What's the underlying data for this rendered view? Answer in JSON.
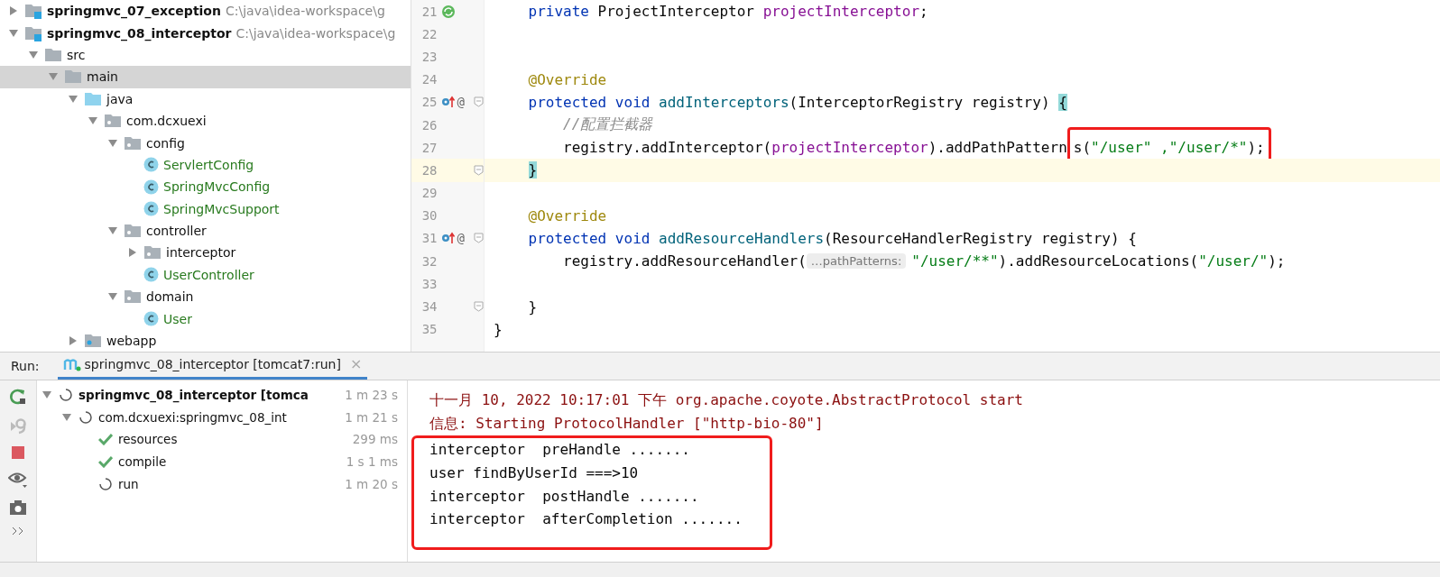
{
  "project_tree": [
    {
      "label": "springmvc_07_exception",
      "kind": "module",
      "path": "C:\\java\\idea-workspace\\g",
      "expanded": false,
      "selected": false
    },
    {
      "label": "springmvc_08_interceptor",
      "kind": "module",
      "path": "C:\\java\\idea-workspace\\g",
      "expanded": true,
      "selected": false,
      "children": [
        {
          "label": "src",
          "kind": "folder",
          "expanded": true,
          "selected": false,
          "children": [
            {
              "label": "main",
              "kind": "folder",
              "expanded": true,
              "selected": true,
              "children": [
                {
                  "label": "java",
                  "kind": "source-folder",
                  "expanded": true,
                  "selected": false,
                  "children": [
                    {
                      "label": "com.dcxuexi",
                      "kind": "package",
                      "expanded": true,
                      "selected": false,
                      "children": [
                        {
                          "label": "config",
                          "kind": "package",
                          "expanded": true,
                          "selected": false,
                          "children": [
                            {
                              "label": "ServlertConfig",
                              "kind": "class",
                              "selected": false
                            },
                            {
                              "label": "SpringMvcConfig",
                              "kind": "class",
                              "selected": false
                            },
                            {
                              "label": "SpringMvcSupport",
                              "kind": "class",
                              "selected": false
                            }
                          ]
                        },
                        {
                          "label": "controller",
                          "kind": "package",
                          "expanded": true,
                          "selected": false,
                          "children": [
                            {
                              "label": "interceptor",
                              "kind": "package",
                              "expanded": false,
                              "selected": false
                            },
                            {
                              "label": "UserController",
                              "kind": "class",
                              "selected": false
                            }
                          ]
                        },
                        {
                          "label": "domain",
                          "kind": "package",
                          "expanded": true,
                          "selected": false,
                          "children": [
                            {
                              "label": "User",
                              "kind": "class",
                              "selected": false
                            }
                          ]
                        }
                      ]
                    }
                  ]
                },
                {
                  "label": "webapp",
                  "kind": "webapp",
                  "expanded": false,
                  "selected": false
                }
              ]
            }
          ]
        }
      ]
    }
  ],
  "editor": {
    "lines": [
      {
        "number": "21",
        "gutter": {
          "kind": "bean"
        },
        "fold": false,
        "current": false,
        "tokens": [
          {
            "text": "    private ",
            "kind": "keyword"
          },
          {
            "text": "ProjectInterceptor ",
            "kind": "plain"
          },
          {
            "text": "projectInterceptor",
            "kind": "field"
          },
          {
            "text": ";",
            "kind": "plain"
          }
        ]
      },
      {
        "number": "22",
        "fold": false,
        "current": false
      },
      {
        "number": "23",
        "fold": false,
        "current": false
      },
      {
        "number": "24",
        "fold": false,
        "current": false,
        "tokens": [
          {
            "text": "    @Override",
            "kind": "annotation"
          }
        ]
      },
      {
        "number": "25",
        "gutter": {
          "kind": "override",
          "text": "@"
        },
        "fold": true,
        "current": false,
        "tokens": [
          {
            "text": "    protected void ",
            "kind": "keyword"
          },
          {
            "text": "addInterceptors",
            "kind": "method"
          },
          {
            "text": "(InterceptorRegistry registry) ",
            "kind": "plain"
          },
          {
            "text": "{",
            "kind": "brace"
          }
        ]
      },
      {
        "number": "26",
        "fold": false,
        "current": false,
        "tokens": [
          {
            "text": "        //配置拦截器",
            "kind": "comment"
          }
        ]
      },
      {
        "number": "27",
        "fold": false,
        "current": false,
        "tokens": [
          {
            "text": "        registry.addInterceptor(",
            "kind": "plain"
          },
          {
            "text": "projectInterceptor",
            "kind": "field"
          },
          {
            "text": ").addPathPattern",
            "kind": "plain"
          },
          {
            "text": "s(",
            "kind": "plain",
            "marked": true
          },
          {
            "text": "\"/user\" ,\"/user/*\"",
            "kind": "string",
            "marked": true
          },
          {
            "text": ");",
            "kind": "plain",
            "marked": true
          }
        ]
      },
      {
        "number": "28",
        "fold": true,
        "current": true,
        "tokens": [
          {
            "text": "    }",
            "kind": "brace"
          }
        ]
      },
      {
        "number": "29",
        "fold": false,
        "current": false
      },
      {
        "number": "30",
        "fold": false,
        "current": false,
        "tokens": [
          {
            "text": "    @Override",
            "kind": "annotation"
          }
        ]
      },
      {
        "number": "31",
        "gutter": {
          "kind": "override",
          "text": "@"
        },
        "fold": true,
        "current": false,
        "tokens": [
          {
            "text": "    protected void ",
            "kind": "keyword"
          },
          {
            "text": "addResourceHandlers",
            "kind": "method"
          },
          {
            "text": "(ResourceHandlerRegistry registry) {",
            "kind": "plain"
          }
        ]
      },
      {
        "number": "32",
        "fold": false,
        "current": false,
        "tokens": [
          {
            "text": "        registry.addResourceHandler(",
            "kind": "plain"
          },
          {
            "text": "…pathPatterns:",
            "kind": "hint"
          },
          {
            "text": "\"/user/**\"",
            "kind": "string"
          },
          {
            "text": ").addResourceLocations(",
            "kind": "plain"
          },
          {
            "text": "\"/user/\"",
            "kind": "string"
          },
          {
            "text": ");",
            "kind": "plain"
          }
        ]
      },
      {
        "number": "33",
        "fold": false,
        "current": false
      },
      {
        "number": "34",
        "fold": true,
        "current": false,
        "tokens": [
          {
            "text": "    }",
            "kind": "plain"
          }
        ]
      },
      {
        "number": "35",
        "fold": false,
        "current": false,
        "tokens": [
          {
            "text": "}",
            "kind": "plain"
          }
        ]
      }
    ]
  },
  "run_panel": {
    "label": "Run:",
    "tab": {
      "title": "springmvc_08_interceptor [tomcat7:run]",
      "selected": true,
      "close_label": "×"
    },
    "tree": [
      {
        "label": "springmvc_08_interceptor [tomca",
        "time": "1 m 23 s",
        "kind": "running",
        "bold": true,
        "expanded": true,
        "children": [
          {
            "label": "com.dcxuexi:springmvc_08_int",
            "time": "1 m 21 s",
            "kind": "running",
            "bold": false,
            "expanded": true,
            "children": [
              {
                "label": "resources",
                "time": "299 ms",
                "kind": "done",
                "bold": false
              },
              {
                "label": "compile",
                "time": "1 s 1 ms",
                "kind": "done",
                "bold": false
              },
              {
                "label": "run",
                "time": "1 m 20 s",
                "kind": "running",
                "bold": false
              }
            ]
          }
        ]
      }
    ],
    "console": [
      {
        "text": "十一月 10, 2022 10:17:01 下午 org.apache.coyote.AbstractProtocol start",
        "kind": "stderr",
        "marked": false
      },
      {
        "text": "信息: Starting ProtocolHandler [\"http-bio-80\"]",
        "kind": "stderr",
        "marked": false
      },
      {
        "text": "interceptor  preHandle .......",
        "kind": "stdout",
        "marked": true
      },
      {
        "text": "user findByUserId ===>10",
        "kind": "stdout",
        "marked": true
      },
      {
        "text": "interceptor  postHandle .......",
        "kind": "stdout",
        "marked": true
      },
      {
        "text": "interceptor  afterCompletion .......",
        "kind": "stdout",
        "marked": true
      }
    ]
  }
}
